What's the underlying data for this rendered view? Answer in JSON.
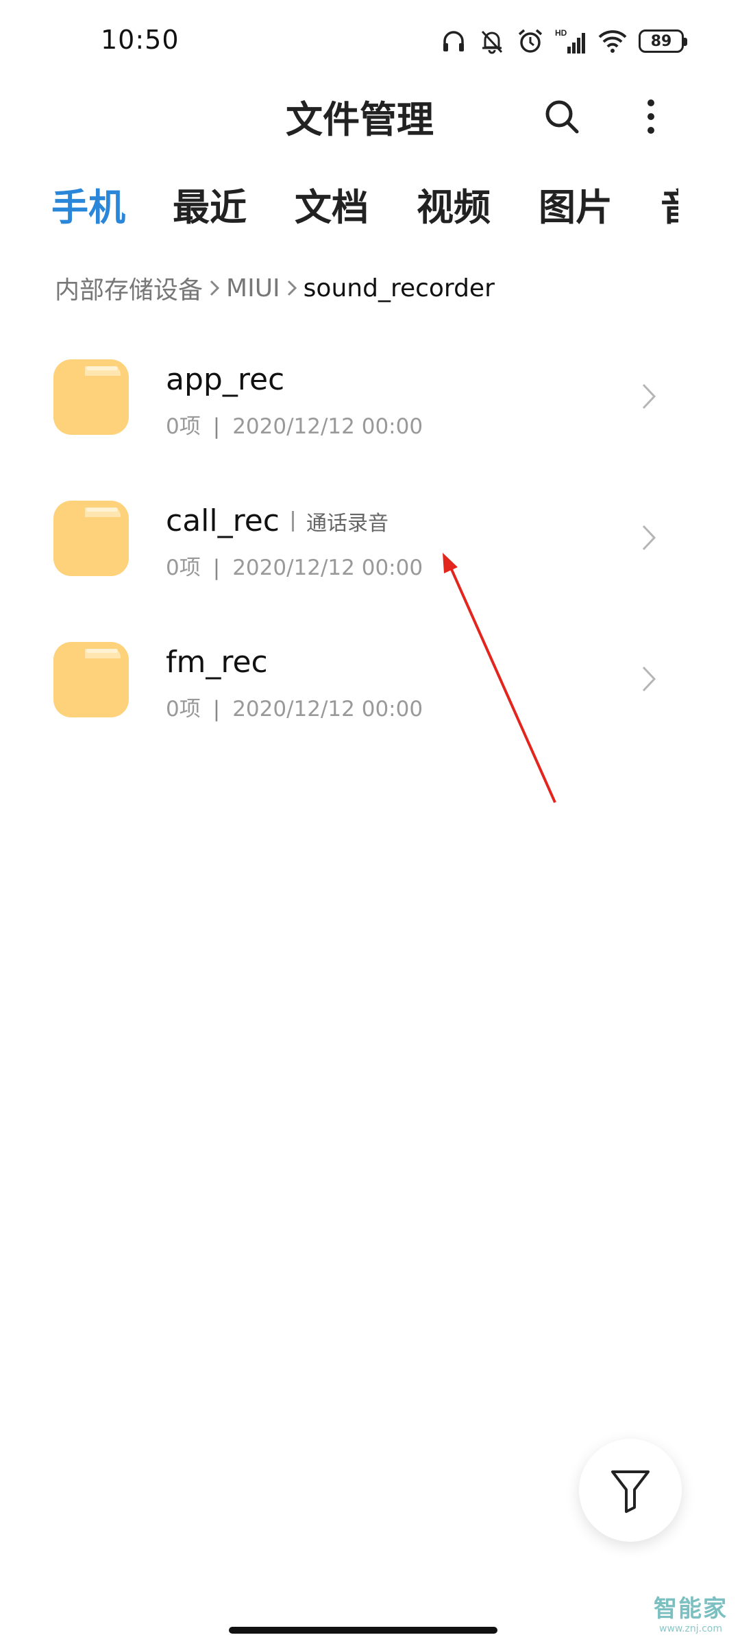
{
  "status_bar": {
    "time": "10:50",
    "battery": "89",
    "icons": [
      "headphones-icon",
      "mute-bell-icon",
      "alarm-icon",
      "hd-signal-icon",
      "wifi-icon",
      "battery-icon"
    ],
    "hd_label": "HD"
  },
  "header": {
    "title": "文件管理",
    "icons": [
      "search-icon",
      "more-vertical-icon"
    ]
  },
  "tabs": [
    {
      "label": "手机",
      "active": true
    },
    {
      "label": "最近",
      "active": false
    },
    {
      "label": "文档",
      "active": false
    },
    {
      "label": "视频",
      "active": false
    },
    {
      "label": "图片",
      "active": false
    },
    {
      "label": "音",
      "active": false
    }
  ],
  "breadcrumb": [
    "内部存储设备",
    "MIUI",
    "sound_recorder"
  ],
  "folders": [
    {
      "name": "app_rec",
      "tag": "",
      "count": "0项",
      "date": "2020/12/12 00:00"
    },
    {
      "name": "call_rec",
      "tag": "通话录音",
      "count": "0项",
      "date": "2020/12/12 00:00"
    },
    {
      "name": "fm_rec",
      "tag": "",
      "count": "0项",
      "date": "2020/12/12 00:00"
    }
  ],
  "fab": {
    "icon": "filter-icon"
  },
  "watermark": {
    "main": "智能家",
    "sub": "www.znj.com"
  },
  "colors": {
    "accent": "#2a86d8",
    "folder": "#fdd27b",
    "annotation_arrow": "#e3261d"
  }
}
